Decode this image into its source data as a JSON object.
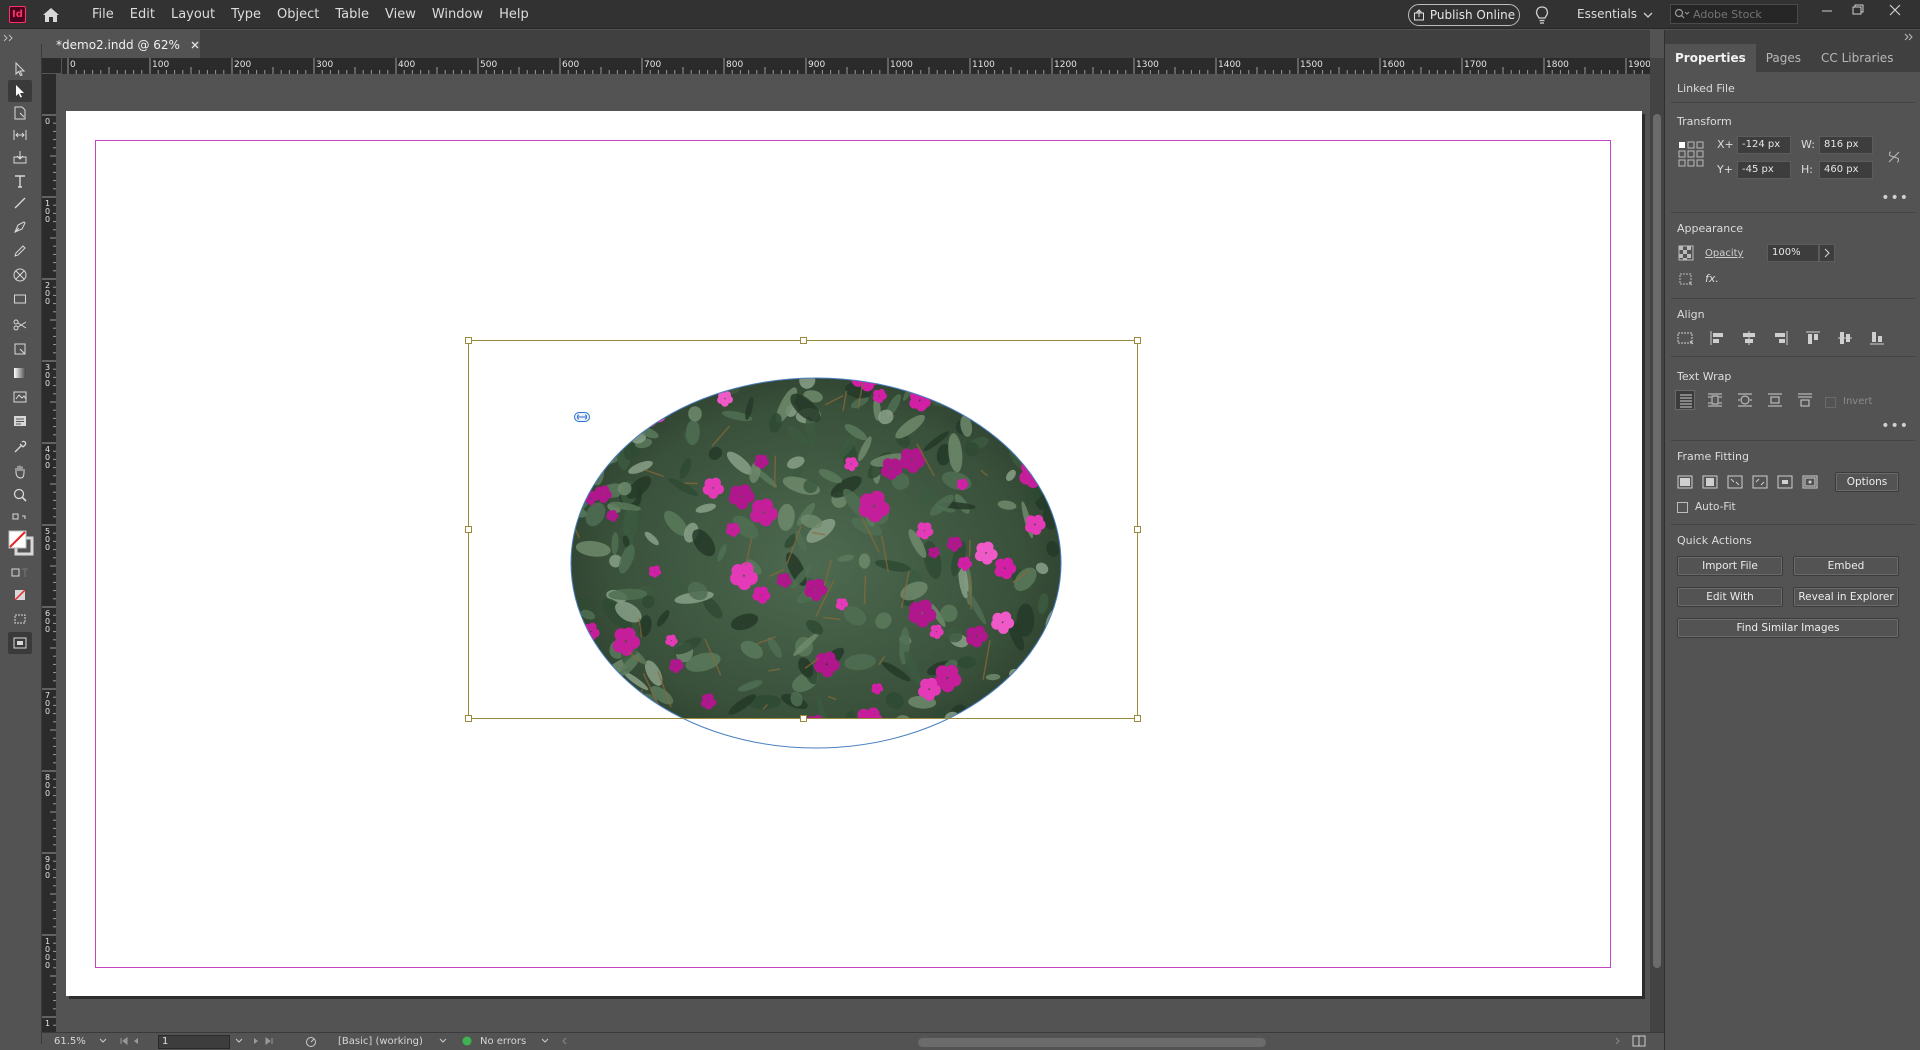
{
  "app": {
    "logo_text": "Id"
  },
  "menu": {
    "items": [
      "File",
      "Edit",
      "Layout",
      "Type",
      "Object",
      "Table",
      "View",
      "Window",
      "Help"
    ]
  },
  "header": {
    "publish_label": "Publish Online",
    "workspace_label": "Essentials",
    "stock_placeholder": "Adobe Stock"
  },
  "document": {
    "tab_title": "*demo2.indd @ 62%"
  },
  "ruler": {
    "h_ticks": [
      "0",
      "100",
      "200",
      "300",
      "400",
      "500",
      "600",
      "700",
      "800",
      "900",
      "1000",
      "1100",
      "1200",
      "1300",
      "1400",
      "1500",
      "1600",
      "1700",
      "1800",
      "1900"
    ],
    "v_ticks": [
      "0",
      "100",
      "200",
      "300",
      "400",
      "500",
      "600",
      "700",
      "800",
      "900",
      "1000",
      "1"
    ]
  },
  "status": {
    "zoom": "61.5%",
    "page": "1",
    "style": "[Basic] (working)",
    "preflight": "No errors"
  },
  "panel": {
    "tabs": [
      "Properties",
      "Pages",
      "CC Libraries"
    ],
    "linked_file": "Linked File",
    "transform": {
      "title": "Transform",
      "x_label": "X+",
      "x_value": "-124 px",
      "y_label": "Y+",
      "y_value": "-45 px",
      "w_label": "W:",
      "w_value": "816 px",
      "h_label": "H:",
      "h_value": "460 px"
    },
    "appearance": {
      "title": "Appearance",
      "opacity_label": "Opacity",
      "opacity_value": "100%",
      "fx_label": "fx."
    },
    "align": {
      "title": "Align"
    },
    "text_wrap": {
      "title": "Text Wrap",
      "invert_label": "Invert"
    },
    "frame_fitting": {
      "title": "Frame Fitting",
      "options_label": "Options",
      "autofit_label": "Auto-Fit"
    },
    "quick_actions": {
      "title": "Quick Actions",
      "import_file": "Import File",
      "embed": "Embed",
      "edit_with": "Edit With",
      "reveal": "Reveal in Explorer",
      "find_similar": "Find Similar Images"
    }
  },
  "colors": {
    "accent_frame": "#9b8a3c",
    "margin_guide": "#c246c2",
    "ellipse_path": "#4a7fc0",
    "status_ok": "#3fb34f"
  }
}
